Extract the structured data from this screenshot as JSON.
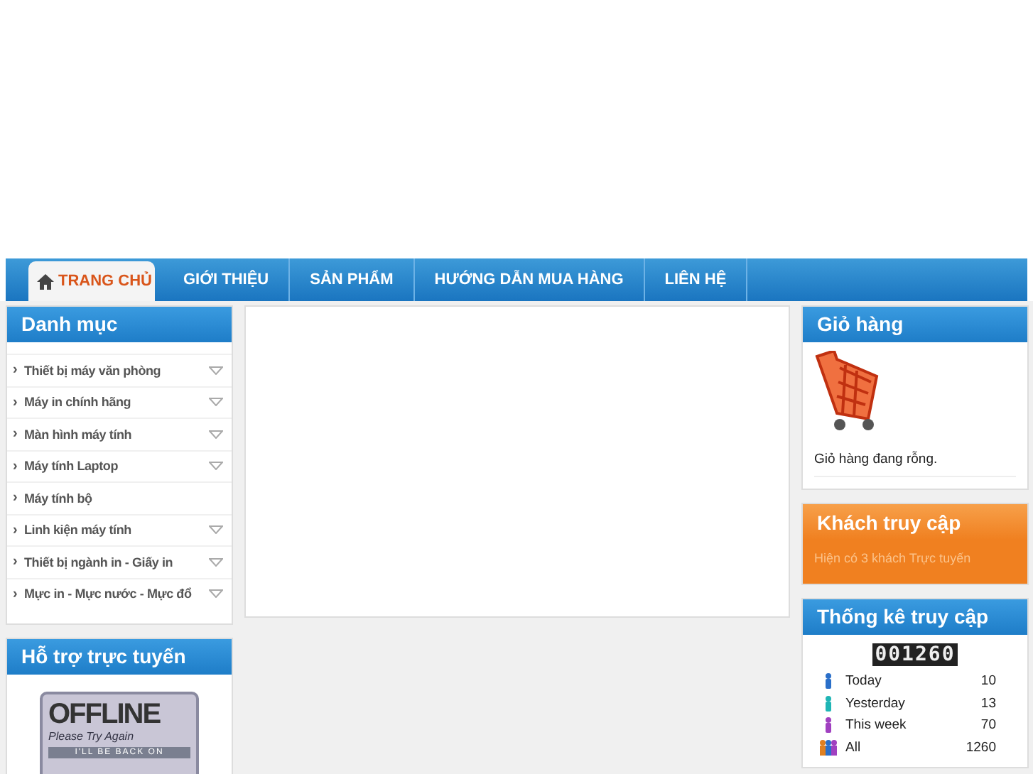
{
  "nav": [
    {
      "kind": "home",
      "label": "TRANG CHỦ",
      "selected": true
    },
    {
      "kind": "text",
      "label": "GIỚI THIỆU",
      "selected": false
    },
    {
      "kind": "text",
      "label": "SẢN PHẨM",
      "selected": false
    },
    {
      "kind": "text",
      "label": "HƯỚNG DẪN MUA HÀNG",
      "selected": false
    },
    {
      "kind": "text",
      "label": "LIÊN HỆ",
      "selected": false
    }
  ],
  "category_panel": {
    "title": "Danh mục",
    "items": [
      {
        "marker": "›",
        "label": "Thiết bị máy văn phòng",
        "has_submenu": true
      },
      {
        "marker": "›",
        "label": "Máy in chính hãng",
        "has_submenu": true
      },
      {
        "marker": "›",
        "label": "Màn hình máy tính",
        "has_submenu": true
      },
      {
        "marker": "›",
        "label": "Máy tính Laptop",
        "has_submenu": true
      },
      {
        "marker": "›",
        "label": "Máy tính bộ",
        "has_submenu": false
      },
      {
        "marker": "›",
        "label": "Linh kiện máy tính",
        "has_submenu": true
      },
      {
        "marker": "›",
        "label": "Thiết bị ngành in - Giấy in",
        "has_submenu": true
      },
      {
        "marker": "›",
        "label": "Mực in - Mực nước - Mực đổ",
        "has_submenu": true
      }
    ]
  },
  "support_panel": {
    "title": "Hỗ trợ trực tuyến",
    "sign": {
      "headline": "OFFLINE",
      "subline": "Please Try Again",
      "footer": "I'LL BE BACK ON"
    }
  },
  "cart_panel": {
    "title": "Giỏ hàng",
    "message": "Giỏ hàng đang rỗng."
  },
  "visitors_panel": {
    "title": "Khách truy cập",
    "message": "Hiện có 3 khách Trực tuyến"
  },
  "stats_panel": {
    "title": "Thống kê truy cập",
    "counter": "001260",
    "rows": [
      {
        "kind": "single",
        "color": "#2a6fc9",
        "label": "Today",
        "value": "10"
      },
      {
        "kind": "single",
        "color": "#1fb5b5",
        "label": "Yesterday",
        "value": "13"
      },
      {
        "kind": "single",
        "color": "#a040c0",
        "label": "This week",
        "value": "70"
      },
      {
        "kind": "group",
        "color": "#e08020",
        "label": "All",
        "value": "1260"
      }
    ]
  }
}
